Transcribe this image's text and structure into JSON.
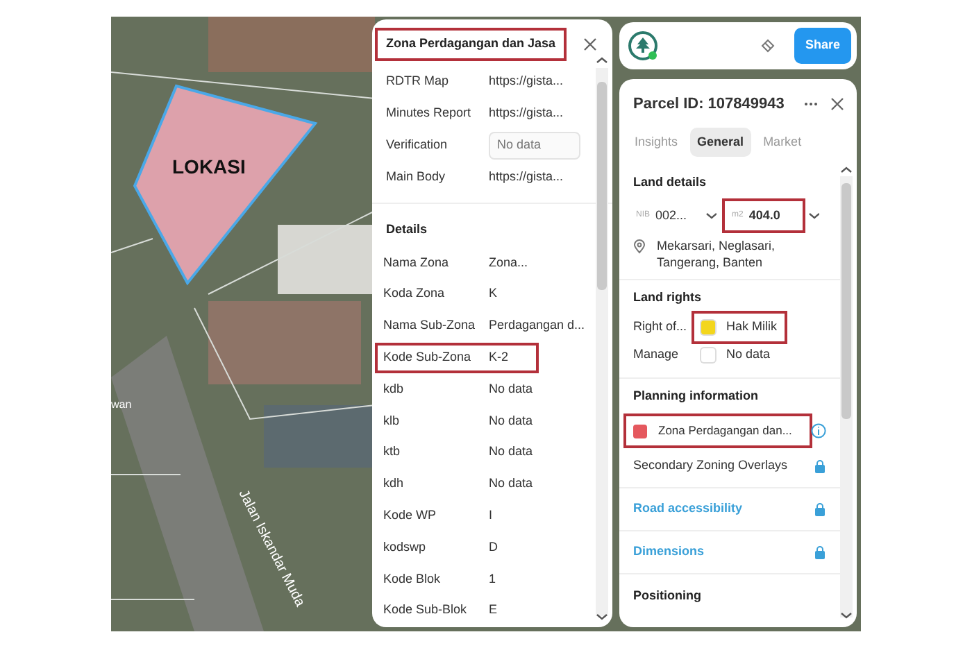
{
  "map": {
    "place_label": "LOKASI",
    "street_label": "Jalan Iskandar Muda",
    "partial_label": "wan"
  },
  "zone_panel": {
    "title": "Zona Perdagangan dan Jasa",
    "title_highlighted": true,
    "links": [
      {
        "label": "RDTR Map",
        "value": "https://gista...",
        "kind": "text"
      },
      {
        "label": "Minutes Report",
        "value": "https://gista...",
        "kind": "text"
      },
      {
        "label": "Verification",
        "placeholder": "No data",
        "kind": "field"
      },
      {
        "label": "Main Body",
        "value": "https://gista...",
        "kind": "text"
      }
    ],
    "details_heading": "Details",
    "details": [
      {
        "label": "Nama Zona",
        "value": "Zona...",
        "highlighted": false
      },
      {
        "label": "Koda Zona",
        "value": "K",
        "highlighted": false
      },
      {
        "label": "Nama Sub-Zona",
        "value": "Perdagangan d...",
        "highlighted": false
      },
      {
        "label": "Kode Sub-Zona",
        "value": "K-2",
        "highlighted": true
      },
      {
        "label": "kdb",
        "value": "No data",
        "highlighted": false
      },
      {
        "label": "klb",
        "value": "No data",
        "highlighted": false
      },
      {
        "label": "ktb",
        "value": "No data",
        "highlighted": false
      },
      {
        "label": "kdh",
        "value": "No data",
        "highlighted": false
      },
      {
        "label": "Kode WP",
        "value": "I",
        "highlighted": false
      },
      {
        "label": "kodswp",
        "value": "D",
        "highlighted": false
      },
      {
        "label": "Kode Blok",
        "value": "1",
        "highlighted": false
      },
      {
        "label": "Kode Sub-Blok",
        "value": "E",
        "highlighted": false
      }
    ]
  },
  "top_bar": {
    "share": "Share"
  },
  "parcel_panel": {
    "title": "Parcel ID: 107849943",
    "tabs": [
      {
        "label": "Insights",
        "selected": false
      },
      {
        "label": "General",
        "selected": true
      },
      {
        "label": "Market",
        "selected": false
      }
    ],
    "land_details": {
      "heading": "Land details",
      "nib_prefix": "NIB",
      "nib": "002...",
      "area_unit": "m2",
      "area": "404.0",
      "area_highlighted": true,
      "address": "Mekarsari, Neglasari, Tangerang, Banten"
    },
    "land_rights": {
      "heading": "Land rights",
      "rows": [
        {
          "label": "Right of...",
          "value": "Hak Milik",
          "color": "#f3d61c",
          "highlighted": true
        },
        {
          "label": "Manage",
          "value": "No data",
          "color": "#ffffff",
          "highlighted": false
        }
      ]
    },
    "planning": {
      "heading": "Planning information",
      "zone": {
        "label": "Zona Perdagangan dan...",
        "color": "#e5585e",
        "highlighted": true
      },
      "sections": [
        {
          "label": "Secondary Zoning Overlays",
          "kind": "plain",
          "locked": true
        },
        {
          "label": "Road accessibility",
          "kind": "link",
          "locked": true
        },
        {
          "label": "Dimensions",
          "kind": "link",
          "locked": true
        }
      ]
    },
    "next_heading": "Positioning"
  }
}
